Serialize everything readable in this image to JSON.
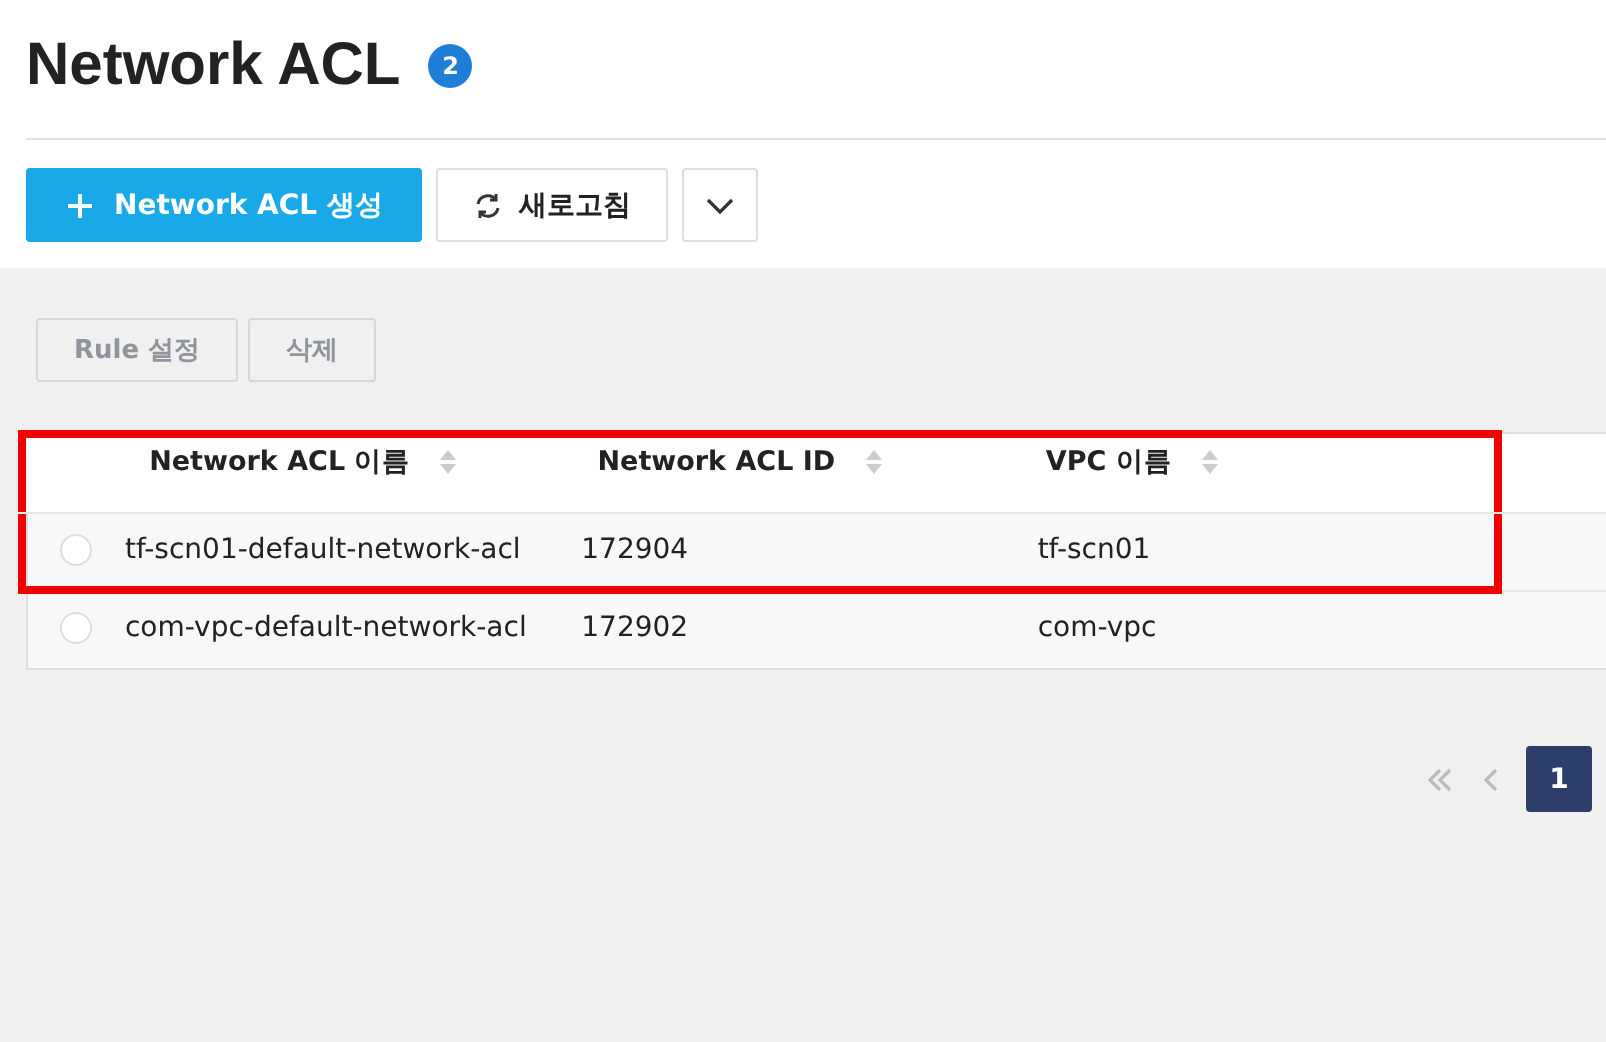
{
  "title": "Network ACL",
  "count": "2",
  "toolbar": {
    "create_button": "Network ACL 생성",
    "refresh_button": "새로고침"
  },
  "actions": [
    {
      "label": "Rule 설정",
      "disabled": true
    },
    {
      "label": "삭제",
      "disabled": true
    }
  ],
  "table": {
    "columns": [
      "Network ACL 이름",
      "Network ACL ID",
      "VPC 이름"
    ],
    "rows": [
      {
        "cells": [
          "tf-scn01-default-network-acl",
          "172904",
          "tf-scn01"
        ],
        "selected": false,
        "highlighted": true
      },
      {
        "cells": [
          "com-vpc-default-network-acl",
          "172902",
          "com-vpc"
        ],
        "selected": false,
        "highlighted": false
      }
    ]
  },
  "pagination": {
    "pages": [
      {
        "label": "1",
        "selected": true
      }
    ]
  }
}
